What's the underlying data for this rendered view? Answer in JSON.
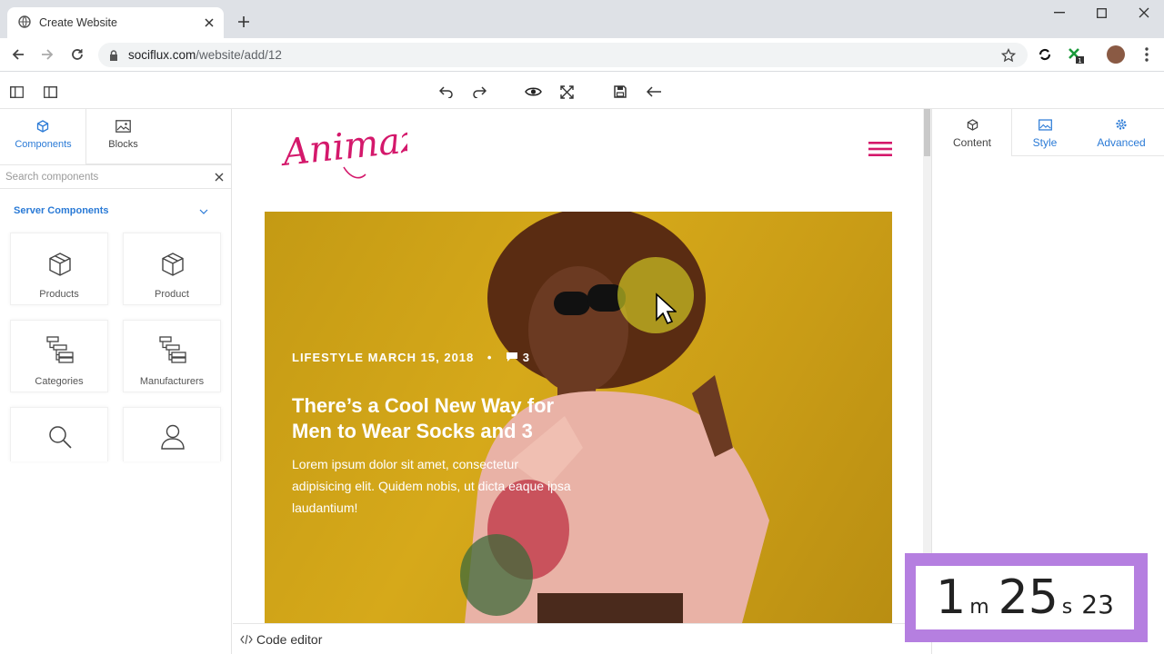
{
  "browser": {
    "tab_title": "Create Website",
    "url_host": "sociflux.com",
    "url_path": "/website/add/12"
  },
  "left_panel": {
    "tabs": [
      {
        "label": "Components",
        "icon": "cube-icon",
        "active": true
      },
      {
        "label": "Blocks",
        "icon": "image-icon",
        "active": false
      }
    ],
    "search_placeholder": "Search components",
    "section_title": "Server Components",
    "components": [
      {
        "label": "Products",
        "icon": "cube-icon"
      },
      {
        "label": "Product",
        "icon": "cube-icon"
      },
      {
        "label": "Categories",
        "icon": "tree-icon"
      },
      {
        "label": "Manufacturers",
        "icon": "tree-icon"
      },
      {
        "label": "",
        "icon": "search-icon"
      },
      {
        "label": "",
        "icon": "user-icon"
      }
    ]
  },
  "canvas": {
    "logo_text": "Animaze",
    "hero": {
      "meta": "LIFESTYLE MARCH 15, 2018",
      "comment_count": "3",
      "title": "There’s a Cool New Way for Men to Wear Socks and 3",
      "text": "Lorem ipsum dolor sit amet, consectetur adipisicing elit. Quidem nobis, ut dicta eaque ipsa laudantium!"
    },
    "code_editor_label": "Code editor"
  },
  "right_panel": {
    "tabs": [
      {
        "label": "Content",
        "icon": "cube-icon"
      },
      {
        "label": "Style",
        "icon": "image-icon"
      },
      {
        "label": "Advanced",
        "icon": "gear-icon"
      }
    ]
  },
  "timer": {
    "minutes": "1",
    "minutes_unit": "m",
    "seconds": "25",
    "seconds_unit": "s",
    "fraction": "23"
  },
  "colors": {
    "accent_blue": "#2a7ad6",
    "brand_pink": "#d4186b",
    "hero_bg": "#c99c16",
    "timer_border": "#b57fe0"
  }
}
